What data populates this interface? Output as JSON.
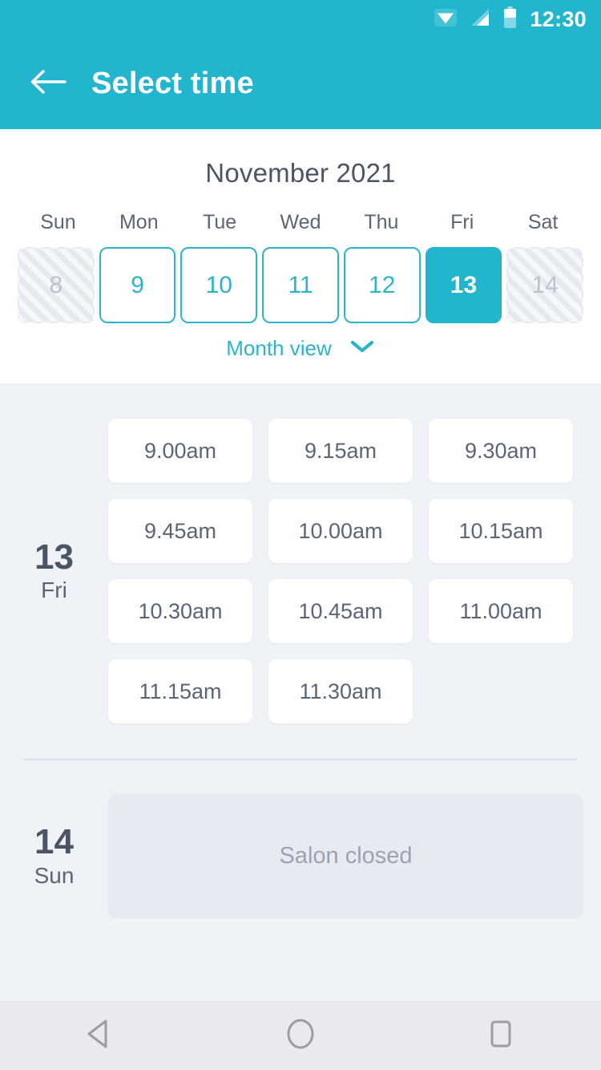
{
  "status_bar": {
    "time": "12:30",
    "icons": [
      "wifi-icon",
      "cellular-signal-icon",
      "battery-icon"
    ]
  },
  "app_bar": {
    "back_icon": "arrow-left-icon",
    "title": "Select time"
  },
  "calendar": {
    "month_label": "November 2021",
    "day_of_week_headers": [
      "Sun",
      "Mon",
      "Tue",
      "Wed",
      "Thu",
      "Fri",
      "Sat"
    ],
    "days": [
      {
        "num": "8",
        "state": "disabled"
      },
      {
        "num": "9",
        "state": "available"
      },
      {
        "num": "10",
        "state": "available"
      },
      {
        "num": "11",
        "state": "available"
      },
      {
        "num": "12",
        "state": "available"
      },
      {
        "num": "13",
        "state": "selected"
      },
      {
        "num": "14",
        "state": "disabled"
      }
    ],
    "month_view_label": "Month view",
    "month_view_chevron": "chevron-down-icon"
  },
  "day_groups": [
    {
      "day_number": "13",
      "day_name": "Fri",
      "slots": [
        "9.00am",
        "9.15am",
        "9.30am",
        "9.45am",
        "10.00am",
        "10.15am",
        "10.30am",
        "10.45am",
        "11.00am",
        "11.15am",
        "11.30am"
      ]
    },
    {
      "day_number": "14",
      "day_name": "Sun",
      "closed_message": "Salon closed"
    }
  ],
  "bottom_nav": {
    "back": "android-back-triangle-icon",
    "home": "android-home-circle-icon",
    "recents": "android-recents-square-icon"
  },
  "colors": {
    "accent": "#22b6ce",
    "accent_border": "#2bb4ca",
    "text_dark": "#4b5566",
    "text_muted": "#5b6577",
    "disabled_text": "#bcc3ce",
    "page_bg": "#eff2f7",
    "card_bg": "#ffffff",
    "closed_bg": "#e7eaf0",
    "closed_text": "#9aa3b3",
    "navbar_bg": "#e8eaee"
  }
}
